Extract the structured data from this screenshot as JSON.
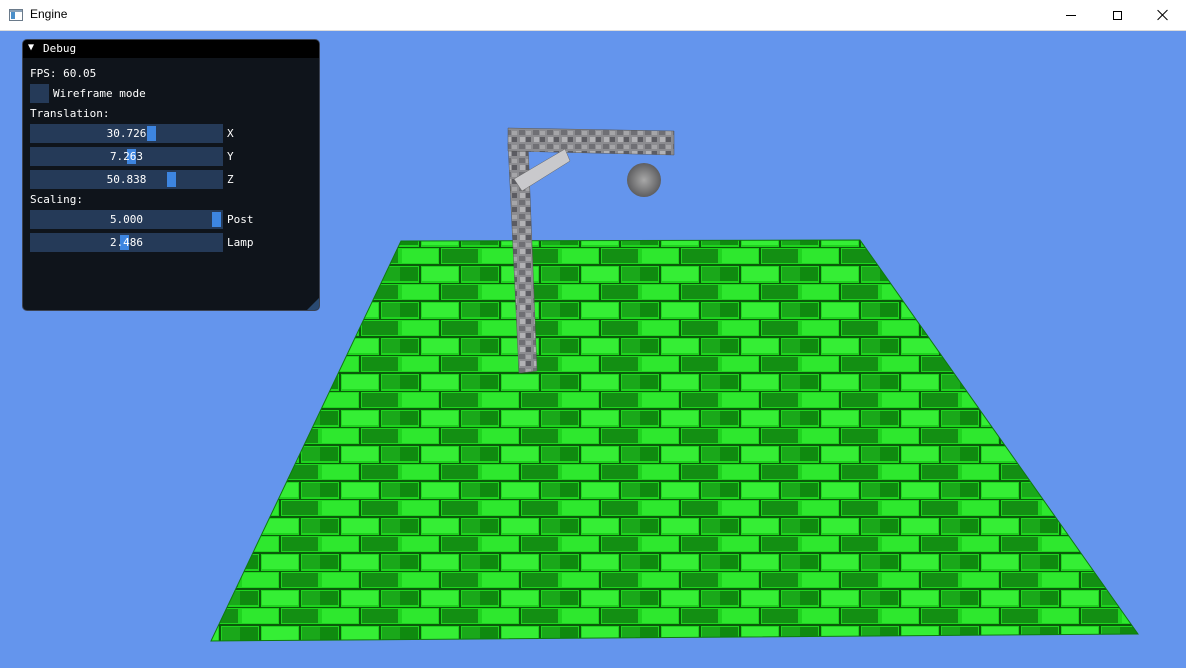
{
  "window": {
    "title": "Engine",
    "app_icon": "window-app-icon",
    "controls": [
      "minimize-icon",
      "maximize-icon",
      "close-icon"
    ]
  },
  "scene": {
    "background_color": "#6495ed",
    "floor_color": "#22e022",
    "post_color": "#8a8a8a"
  },
  "debug": {
    "title": "Debug",
    "fps_label": "FPS:",
    "fps_value": "60.05",
    "wireframe_label": "Wireframe mode",
    "wireframe_checked": false,
    "translation_label": "Translation:",
    "translation": [
      {
        "value": "30.726",
        "axis": "X",
        "fraction": 0.64
      },
      {
        "value": "7.263",
        "axis": "Y",
        "fraction": 0.53
      },
      {
        "value": "50.838",
        "axis": "Z",
        "fraction": 0.75
      }
    ],
    "scaling_label": "Scaling:",
    "scaling": [
      {
        "value": "5.000",
        "axis": "Post",
        "fraction": 1.0
      },
      {
        "value": "2.486",
        "axis": "Lamp",
        "fraction": 0.49
      }
    ]
  }
}
